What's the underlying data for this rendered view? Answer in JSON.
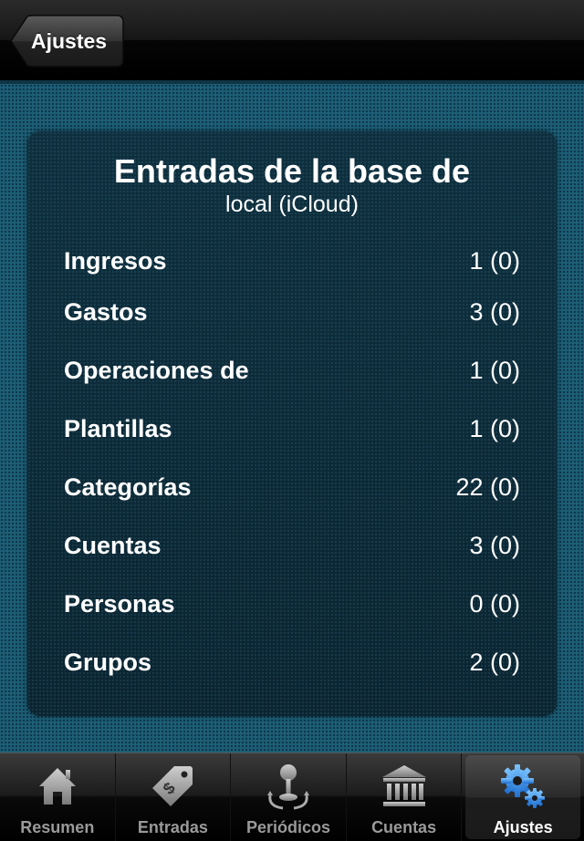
{
  "navbar": {
    "back_label": "Ajustes"
  },
  "panel": {
    "title": "Entradas de la base de",
    "subtitle": "local (iCloud)",
    "rows": [
      {
        "label": "Ingresos",
        "value": "1 (0)"
      },
      {
        "label": "Gastos",
        "value": "3 (0)"
      },
      {
        "label": "Operaciones de",
        "value": "1 (0)"
      },
      {
        "label": "Plantillas",
        "value": "1 (0)"
      },
      {
        "label": "Categorías",
        "value": "22 (0)"
      },
      {
        "label": "Cuentas",
        "value": "3 (0)"
      },
      {
        "label": "Personas",
        "value": "0 (0)"
      },
      {
        "label": "Grupos",
        "value": "2 (0)"
      }
    ]
  },
  "tabbar": {
    "tabs": [
      {
        "label": "Resumen",
        "icon": "house-icon",
        "selected": false
      },
      {
        "label": "Entradas",
        "icon": "price-tag-icon",
        "selected": false
      },
      {
        "label": "Periódicos",
        "icon": "joystick-repeat-icon",
        "selected": false
      },
      {
        "label": "Cuentas",
        "icon": "bank-icon",
        "selected": false
      },
      {
        "label": "Ajustes",
        "icon": "gears-icon",
        "selected": true
      }
    ]
  },
  "colors": {
    "background_blue": "#1d5f77",
    "panel_dark": "#0d2a37",
    "selected_icon_blue": "#3aa0ff"
  }
}
